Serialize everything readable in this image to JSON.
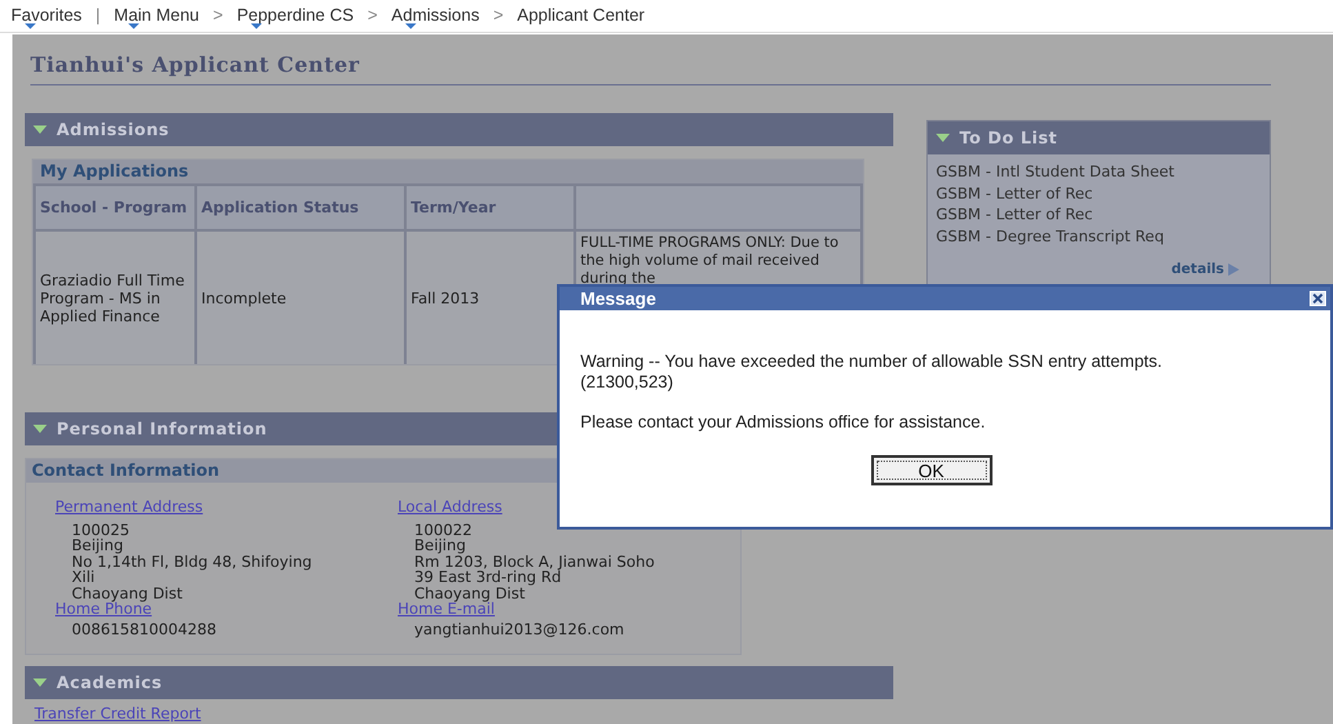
{
  "breadcrumb": [
    {
      "label": "Favorites",
      "dropdown": true,
      "separator": "|"
    },
    {
      "label": "Main Menu",
      "dropdown": true,
      "separator": ">"
    },
    {
      "label": "Pepperdine CS",
      "dropdown": true,
      "separator": ">"
    },
    {
      "label": "Admissions",
      "dropdown": true,
      "separator": ">"
    },
    {
      "label": "Applicant Center",
      "dropdown": false
    }
  ],
  "page_title": "Tianhui's Applicant Center",
  "admissions": {
    "title": "Admissions",
    "expanded": true,
    "my_applications": {
      "title": "My Applications",
      "columns": [
        "School - Program",
        "Application Status",
        "Term/Year",
        ""
      ],
      "rows": [
        [
          "Graziadio Full Time Program - MS in Applied Finance",
          "Incomplete",
          "Fall 2013",
          "FULL-TIME PROGRAMS ONLY: Due to the high volume of mail received during the"
        ]
      ]
    }
  },
  "todo": {
    "title": "To Do List",
    "expanded": true,
    "items": [
      "GSBM - Intl Student Data Sheet",
      "GSBM - Letter of Rec",
      "GSBM - Letter of Rec",
      "GSBM - Degree Transcript Req"
    ],
    "details_link": "details"
  },
  "personal": {
    "title": "Personal Information",
    "expanded": true,
    "contact": {
      "title": "Contact Information",
      "columns": [
        {
          "address_label": "Permanent Address",
          "address_lines": [
            "100025",
            "Beijing",
            "No 1,14th Fl, Bldg 48, Shifoying",
            "Xili",
            "Chaoyang Dist"
          ],
          "contact_label": "Home Phone",
          "contact_value": "008615810004288"
        },
        {
          "address_label": "Local Address",
          "address_lines": [
            "100022",
            "Beijing",
            "Rm 1203, Block A, Jianwai Soho",
            "39 East 3rd-ring Rd",
            "Chaoyang Dist"
          ],
          "contact_label": "Home E-mail",
          "contact_value": "yangtianhui2013@126.com"
        }
      ]
    }
  },
  "academics": {
    "title": "Academics",
    "expanded": true,
    "links": [
      "Transfer Credit Report"
    ]
  },
  "dialog": {
    "title": "Message",
    "message_lines": [
      "Warning -- You have exceeded the number of allowable SSN entry attempts.",
      "(21300,523)"
    ],
    "note": "Please contact your Admissions office for assistance.",
    "button": "OK"
  }
}
